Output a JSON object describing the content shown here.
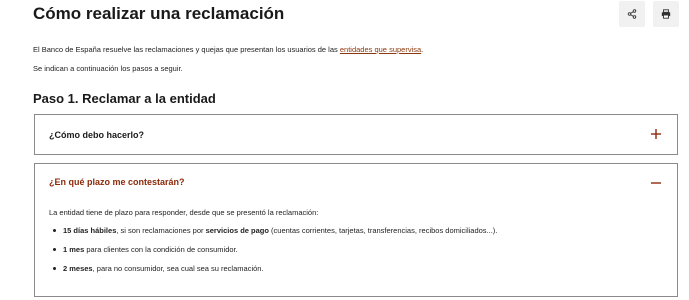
{
  "page": {
    "title": "Cómo realizar una reclamación"
  },
  "actions": {
    "share_icon": "share-icon",
    "print_icon": "print-icon"
  },
  "intro": {
    "line1_text": "El Banco de España resuelve las reclamaciones y quejas que presentan los usuarios de las ",
    "line1_link": "entidades que supervisa",
    "line1_end": ".",
    "line2": "Se indican a continuación los pasos a seguir."
  },
  "step": {
    "title": "Paso 1. Reclamar a la entidad"
  },
  "accordion": [
    {
      "question": "¿Cómo debo hacerlo?",
      "expanded": false
    },
    {
      "question": "¿En qué plazo me contestarán?",
      "expanded": true,
      "intro": "La entidad tiene de plazo para responder, desde que se presentó la reclamación:",
      "bullets": [
        {
          "bold": "15 días hábiles",
          "text1": ", si son reclamaciones por ",
          "bold2": "servicios de pago",
          "text2": " (cuentas corrientes, tarjetas, transferencias, recibos domiciliados...)."
        },
        {
          "bold": "1 mes",
          "text1": " para clientes con la condición de consumidor."
        },
        {
          "bold": "2 meses",
          "text1": ", para no consumidor, sea cual sea su reclamación."
        }
      ]
    }
  ],
  "colors": {
    "accent": "#8b2a0a",
    "link": "#8b3a0f",
    "border": "#8a8a8a",
    "button_bg": "#f1f1f1"
  }
}
